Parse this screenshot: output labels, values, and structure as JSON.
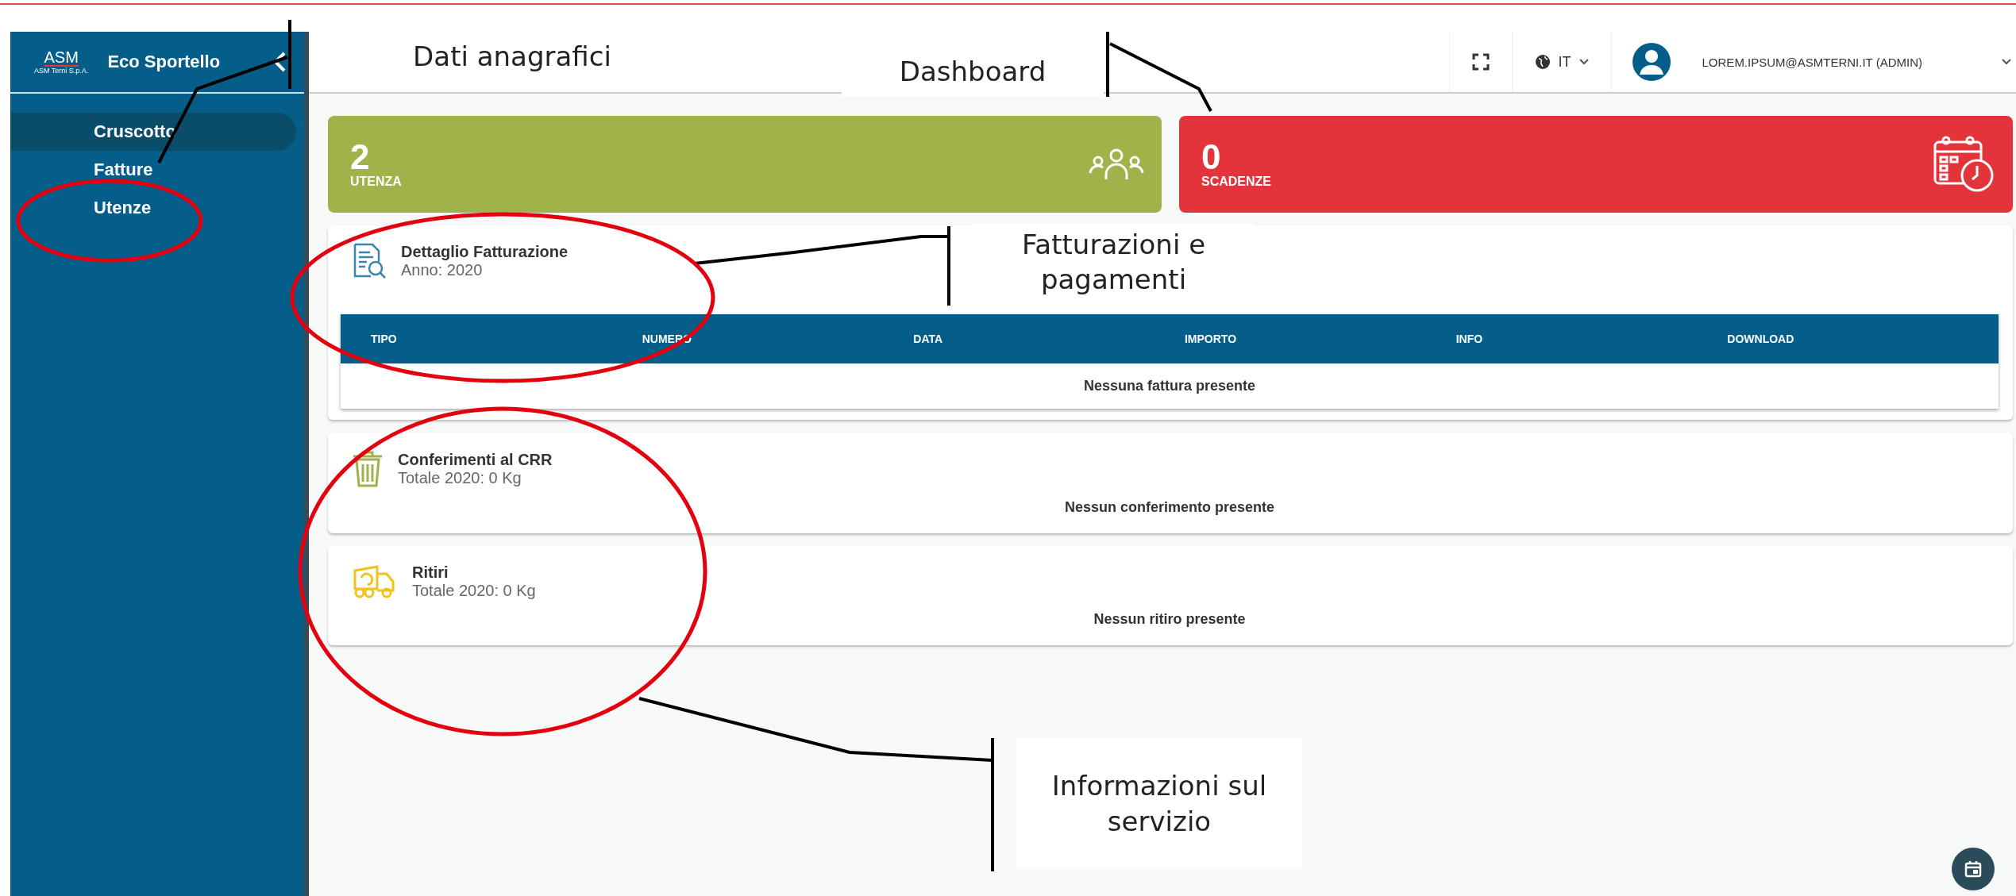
{
  "sidebar": {
    "logo": "ASM",
    "logo_subtitle": "ASM Terni S.p.A.",
    "title": "Eco Sportello",
    "items": [
      {
        "label": "Cruscotto",
        "selected": true
      },
      {
        "label": "Fatture",
        "selected": false
      },
      {
        "label": "Utenze",
        "selected": false
      }
    ]
  },
  "topbar": {
    "language": "IT",
    "user": "LOREM.IPSUM@ASMTERNI.IT (ADMIN)"
  },
  "stat_cards": [
    {
      "value": "2",
      "label": "UTENZA",
      "color": "#a0b24a",
      "kind": "people"
    },
    {
      "value": "0",
      "label": "SCADENZE",
      "color": "#e3343b",
      "kind": "calendar"
    }
  ],
  "sections": [
    {
      "kind": "invoice",
      "title": "Dettaglio Fatturazione",
      "subtitle": "Anno: 2020",
      "columns": [
        "TIPO",
        "NUMERO",
        "DATA",
        "IMPORTO",
        "INFO",
        "DOWNLOAD"
      ],
      "empty": "Nessuna fattura presente"
    },
    {
      "kind": "bin",
      "title": "Conferimenti al CRR",
      "subtitle": "Totale 2020: 0 Kg",
      "empty": "Nessun conferimento presente"
    },
    {
      "kind": "truck",
      "title": "Ritiri",
      "subtitle": "Totale 2020: 0 Kg",
      "empty": "Nessun ritiro presente"
    }
  ],
  "annotations": [
    {
      "kind": "box",
      "lines": [
        "Dati anagrafici"
      ]
    },
    {
      "kind": "box",
      "lines": [
        "Dashboard"
      ]
    },
    {
      "kind": "box",
      "lines": [
        "Fatturazioni e",
        "pagamenti"
      ]
    },
    {
      "kind": "box",
      "lines": [
        "Informazioni sul",
        "servizio"
      ]
    }
  ]
}
